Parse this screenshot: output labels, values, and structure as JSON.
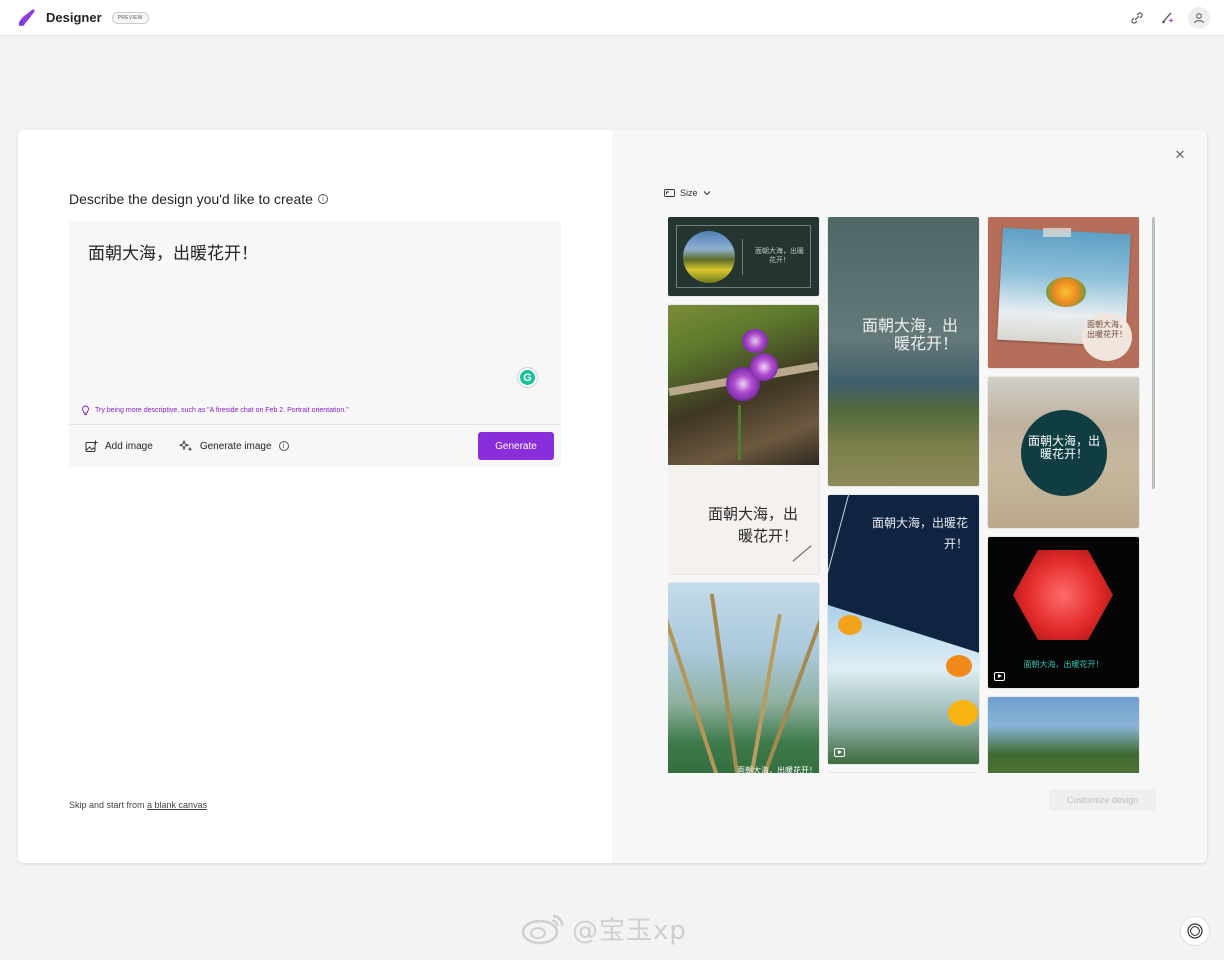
{
  "app": {
    "brand": "Designer",
    "badge": "PREVIEW",
    "accent": "#8a2ddb"
  },
  "topbar_icons": [
    "share-link-icon",
    "sparkle-design-icon",
    "account-icon"
  ],
  "left_panel": {
    "heading": "Describe the design you'd like to create",
    "prompt_value": "面朝大海，出暖花开！",
    "tip": "Try being more descriptive, such as \"A fireside chat on Feb 2. Portrait orientation.\"",
    "add_image": "Add image",
    "generate_image": "Generate image",
    "generate": "Generate",
    "skip_prefix": "Skip and start from ",
    "skip_link": "a blank canvas"
  },
  "right_panel": {
    "size_label": "Size",
    "customize": "Customize design",
    "designs": [
      {
        "caption": "面朝大海，出暖花开！"
      },
      {
        "caption": "面朝大海，出暖花开！"
      },
      {
        "caption": "面朝大海，出暖花开！"
      },
      {
        "caption": "面朝大海，出暖花开！"
      },
      {
        "caption": "面朝大海，出暖花开！"
      },
      {
        "caption": "面朝大海，出暖花开！"
      },
      {
        "caption": "面朝大海，出暖花开！"
      },
      {
        "caption": "面朝大海，出暖花开！"
      }
    ]
  },
  "watermark": "@宝玉xp"
}
